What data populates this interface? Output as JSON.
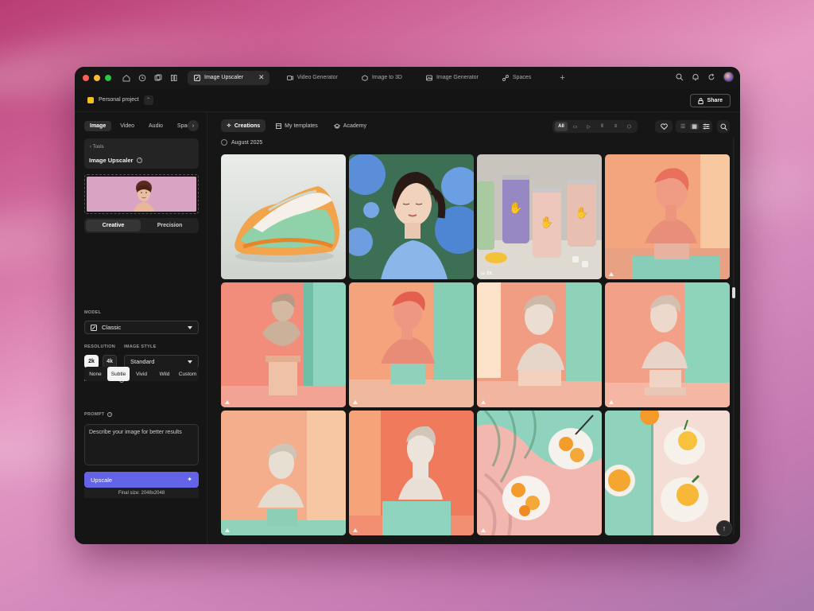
{
  "colors": {
    "window_bg": "#141414",
    "accent": "#6263e6",
    "traffic_red": "#ff5f57",
    "traffic_yellow": "#febc2e",
    "traffic_green": "#28c840",
    "project_square": "#f2c21b"
  },
  "titlebar": {
    "tabs": [
      {
        "label": "Image Upscaler",
        "icon": "image-upscaler-icon",
        "active": true
      },
      {
        "label": "Video Generator",
        "icon": "video-icon"
      },
      {
        "label": "Image to 3D",
        "icon": "cube-icon"
      },
      {
        "label": "Image Generator",
        "icon": "image-icon"
      },
      {
        "label": "Spaces",
        "icon": "spaces-icon"
      }
    ],
    "new_tab": "+",
    "close_glyph": "✕"
  },
  "project": {
    "name": "Personal project",
    "share_label": "Share"
  },
  "sidebar": {
    "tabs": [
      "Image",
      "Video",
      "Audio",
      "Spaces"
    ],
    "tool_back": "Tools",
    "tool_title": "Image Upscaler",
    "modes": [
      "Creative",
      "Precision"
    ],
    "model_label": "MODEL",
    "model_value": "Classic",
    "resolution_label": "RESOLUTION",
    "resolution_options": [
      "2k",
      "4k"
    ],
    "resolution_selected": "2k",
    "style_label": "IMAGE STYLE",
    "style_value": "Standard",
    "imagination_label": "IMAGINATION",
    "imagination_options": [
      "None",
      "Subtle",
      "Vivid",
      "Wild",
      "Custom"
    ],
    "imagination_selected": "Subtle",
    "prompt_label": "PROMPT",
    "prompt_placeholder": "Describe your image for better results",
    "upscale_label": "Upscale",
    "final_size": "Final size: 2048x2048"
  },
  "main": {
    "tabs": [
      {
        "label": "Creations",
        "icon": "sparkle-icon",
        "active": true
      },
      {
        "label": "My templates",
        "icon": "template-icon"
      },
      {
        "label": "Academy",
        "icon": "academy-icon"
      }
    ],
    "filter_all": "All",
    "date_group": "August 2025",
    "tiles": [
      {
        "name": "tile-sneaker",
        "badge": ""
      },
      {
        "name": "tile-woman-flowers",
        "badge": ""
      },
      {
        "name": "tile-cans",
        "badge": "2X"
      },
      {
        "name": "tile-bust-1",
        "badge": "△"
      },
      {
        "name": "tile-bust-2",
        "badge": "△"
      },
      {
        "name": "tile-bust-3",
        "badge": "△"
      },
      {
        "name": "tile-bust-4",
        "badge": "△"
      },
      {
        "name": "tile-bust-5",
        "badge": "△"
      },
      {
        "name": "tile-bust-6",
        "badge": "△"
      },
      {
        "name": "tile-bust-7",
        "badge": "△"
      },
      {
        "name": "tile-oranges-1",
        "badge": "△"
      },
      {
        "name": "tile-oranges-2",
        "badge": ""
      }
    ]
  }
}
